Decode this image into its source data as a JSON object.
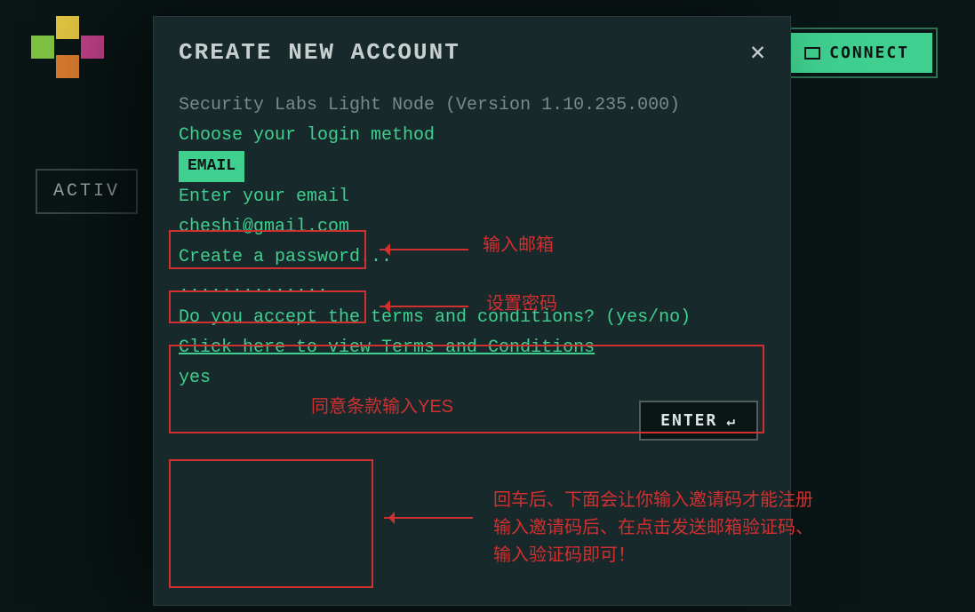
{
  "header": {
    "connect_label": "CONNECT",
    "activity_label": "ACTIV"
  },
  "modal": {
    "title": "CREATE NEW ACCOUNT",
    "version_line": "Security Labs Light Node (Version 1.10.235.000)",
    "choose_method": "Choose your login method",
    "email_badge": "EMAIL",
    "enter_email": "Enter your email",
    "email_value": "cheshi@gmail.com",
    "create_password": "Create a password...",
    "password_value": "..............",
    "accept_terms": "Do you accept the terms and conditions? (yes/no)",
    "tc_link": "Click here to view Terms and Conditions",
    "yes_value": "yes",
    "enter_label": "ENTER"
  },
  "annotations": {
    "a1": "输入邮箱",
    "a2": "设置密码",
    "a3": "同意条款输入YES",
    "a4": "回车后、下面会让你输入邀请码才能注册\n输入邀请码后、在点击发送邮箱验证码、\n输入验证码即可！"
  }
}
